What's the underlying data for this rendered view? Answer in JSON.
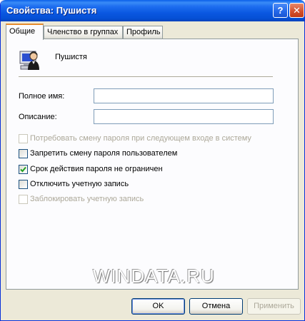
{
  "window": {
    "title": "Свойства: Пушистя",
    "help_label": "?",
    "close_label": "✕"
  },
  "tabs": [
    {
      "label": "Общие",
      "active": true
    },
    {
      "label": "Членство в группах",
      "active": false
    },
    {
      "label": "Профиль",
      "active": false
    }
  ],
  "user": {
    "name": "Пушистя",
    "icon": "user-computer-icon"
  },
  "fields": {
    "full_name": {
      "label": "Полное имя:",
      "value": ""
    },
    "description": {
      "label": "Описание:",
      "value": ""
    }
  },
  "checkboxes": [
    {
      "label": "Потребовать смену пароля при следующем входе в систему",
      "checked": false,
      "enabled": false
    },
    {
      "label": "Запретить смену пароля пользователем",
      "checked": false,
      "enabled": true
    },
    {
      "label": "Срок действия пароля не ограничен",
      "checked": true,
      "enabled": true
    },
    {
      "label": "Отключить учетную запись",
      "checked": false,
      "enabled": true
    },
    {
      "label": "Заблокировать учетную запись",
      "checked": false,
      "enabled": false
    }
  ],
  "watermark": "WINDATA.RU",
  "buttons": {
    "ok": "OK",
    "cancel": "Отмена",
    "apply": "Применить"
  },
  "colors": {
    "titlebar": "#0a58e1",
    "dialog_bg": "#ece9d8",
    "check": "#21a121",
    "active_tab_accent": "#e68b2c"
  }
}
